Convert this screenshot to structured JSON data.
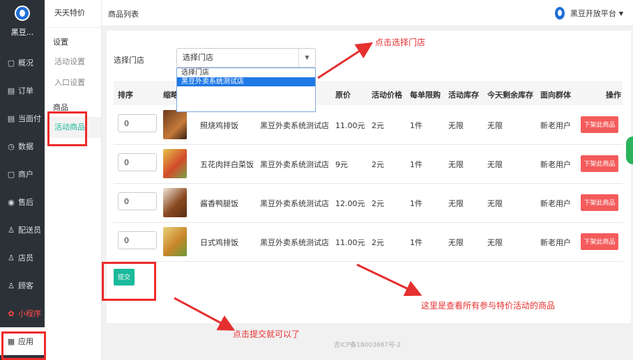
{
  "sidebar": {
    "logo_text": "黑豆...",
    "items": [
      {
        "icon": "▢",
        "label": "概况"
      },
      {
        "icon": "▤",
        "label": "订单"
      },
      {
        "icon": "▤",
        "label": "当面付"
      },
      {
        "icon": "◷",
        "label": "数据"
      },
      {
        "icon": "▢",
        "label": "商户"
      },
      {
        "icon": "◉",
        "label": "售后"
      },
      {
        "icon": "♙",
        "label": "配送员"
      },
      {
        "icon": "♙",
        "label": "店员"
      },
      {
        "icon": "♙",
        "label": "顾客"
      },
      {
        "icon": "✿",
        "label": "小程序"
      },
      {
        "icon": "▦",
        "label": "应用"
      }
    ]
  },
  "subnav": {
    "title": "天天特价",
    "group1": "设置",
    "item_activity_settings": "活动设置",
    "item_entry_settings": "入口设置",
    "group2": "商品",
    "item_activity_goods": "活动商品"
  },
  "header": {
    "breadcrumb": "商品列表",
    "platform": "黑豆开放平台"
  },
  "filter": {
    "label": "选择门店",
    "selected": "选择门店",
    "options": [
      "选择门店",
      "黑豆外卖系统测试店"
    ]
  },
  "table": {
    "headers": {
      "sort": "排序",
      "thumb": "缩略",
      "price": "原价",
      "activity_price": "活动价格",
      "limit": "每单限购",
      "stock": "活动库存",
      "remaining": "今天剩余库存",
      "audience": "面向群体",
      "action": "操作"
    },
    "rows": [
      {
        "sort": "0",
        "name": "照烧鸡排饭",
        "store": "黑豆外卖系统测试店",
        "price": "11.00元",
        "activity_price": "2元",
        "limit": "1件",
        "stock": "无限",
        "remaining": "无限",
        "audience": "新老用户",
        "action": "下架此商品"
      },
      {
        "sort": "0",
        "name": "五花肉拌白菜饭",
        "store": "黑豆外卖系统测试店",
        "price": "9元",
        "activity_price": "2元",
        "limit": "1件",
        "stock": "无限",
        "remaining": "无限",
        "audience": "新老用户",
        "action": "下架此商品"
      },
      {
        "sort": "0",
        "name": "酱香鸭腿饭",
        "store": "黑豆外卖系统测试店",
        "price": "12.00元",
        "activity_price": "2元",
        "limit": "1件",
        "stock": "无限",
        "remaining": "无限",
        "audience": "新老用户",
        "action": "下架此商品"
      },
      {
        "sort": "0",
        "name": "日式鸡排饭",
        "store": "黑豆外卖系统测试店",
        "price": "11.00元",
        "activity_price": "2元",
        "limit": "1件",
        "stock": "无限",
        "remaining": "无限",
        "audience": "新老用户",
        "action": "下架此商品"
      }
    ],
    "submit_label": "提交"
  },
  "footer": "吉ICP备18003687号-2",
  "annotations": {
    "select_store": "点击选择门店",
    "view_goods": "这里是查看所有参与特价活动的商品",
    "click_submit": "点击提交就可以了"
  }
}
